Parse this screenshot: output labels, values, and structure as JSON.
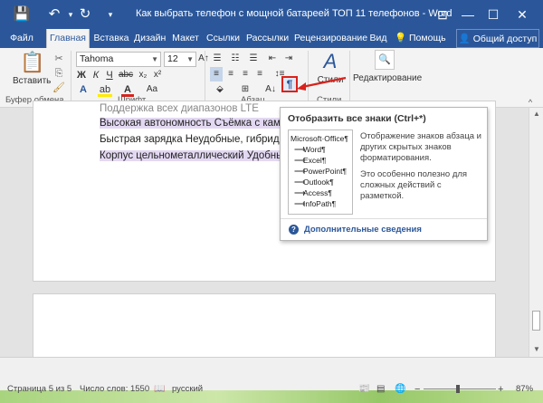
{
  "window": {
    "title": "Как выбрать телефон с мощной батареей ТОП 11 телефонов - Word",
    "quick_access": [
      "save-icon",
      "undo-icon",
      "redo-icon",
      "customize-icon"
    ],
    "controls": [
      "ribbon-display-icon",
      "minimize-icon",
      "maximize-icon",
      "close-icon"
    ]
  },
  "tabs": {
    "items": [
      "Файл",
      "Главная",
      "Вставка",
      "Дизайн",
      "Макет",
      "Ссылки",
      "Рассылки",
      "Рецензирование",
      "Вид"
    ],
    "active": "Главная",
    "help": "Помощь",
    "share": "Общий доступ"
  },
  "ribbon": {
    "clipboard": {
      "paste_label": "Вставить",
      "group_label": "Буфер обмена"
    },
    "font": {
      "name": "Tahoma",
      "size": "12",
      "group_label": "Шрифт",
      "bold": "Ж",
      "italic": "К",
      "underline": "Ч"
    },
    "paragraph": {
      "group_label": "Абзац",
      "pilcrow": "¶"
    },
    "styles": {
      "label": "Стили",
      "group_label": "Стили"
    },
    "editing": {
      "label": "Редактирование"
    }
  },
  "document": {
    "lines": [
      {
        "text": "Поддержка всех диапазонов LTE",
        "highlight": false
      },
      {
        "text": "Высокая автономность Съёмка с камеры т",
        "highlight": true
      },
      {
        "text": "Быстрая зарядка Неудобные, гибридные с",
        "highlight": false
      },
      {
        "text": "Корпус цельнометаллический Удобные ф",
        "highlight": true
      }
    ]
  },
  "tooltip": {
    "title": "Отобразить все знаки (Ctrl+*)",
    "preview": [
      "Microsoft·Office¶",
      "Word¶",
      "Excel¶",
      "PowerPoint¶",
      "Outlook¶",
      "Access¶",
      "InfoPath¶"
    ],
    "description1": "Отображение знаков абзаца и других скрытых знаков форматирования.",
    "description2": "Это особенно полезно для сложных действий с разметкой.",
    "more": "Дополнительные сведения"
  },
  "status": {
    "page": "Страница 5 из 5",
    "words": "Число слов: 1550",
    "language": "русский",
    "zoom": "87%",
    "zoom_minus": "−",
    "zoom_plus": "+"
  }
}
